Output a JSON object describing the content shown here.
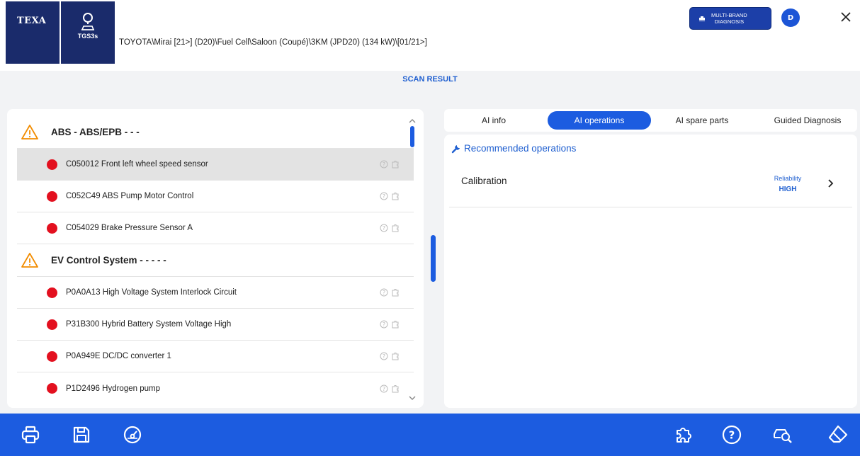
{
  "header": {
    "texa_logo": "TEXA",
    "tgs_logo": "TGS3s",
    "vehicle_path": "TOYOTA\\Mirai [21>] (D20)\\Fuel Cell\\Saloon (Coupé)\\3KM (JPD20) (134 kW)\\[01/21>]",
    "multi_brand_line1": "MULTI-BRAND",
    "multi_brand_line2": "DIAGNOSIS",
    "avatar_initial": "D"
  },
  "title": "SCAN RESULT",
  "groups": [
    {
      "label": "ABS - ABS/EPB - - -",
      "faults": [
        {
          "label": "C050012 Front left wheel speed sensor",
          "status_color": "#e3101f"
        },
        {
          "label": "C052C49 ABS Pump Motor Control",
          "status_color": "#e3101f"
        },
        {
          "label": "C054029 Brake Pressure Sensor A",
          "status_color": "#e3101f"
        }
      ]
    },
    {
      "label": "EV Control System - - - - -",
      "faults": [
        {
          "label": "P0A0A13 High Voltage System Interlock Circuit",
          "status_color": "#e3101f"
        },
        {
          "label": "P31B300 Hybrid Battery System Voltage High",
          "status_color": "#e3101f"
        },
        {
          "label": "P0A949E DC/DC converter 1",
          "status_color": "#e3101f"
        },
        {
          "label": "P1D2496 Hydrogen pump",
          "status_color": "#e3101f"
        }
      ]
    }
  ],
  "tabs": [
    {
      "label": "AI info",
      "active": false
    },
    {
      "label": "AI operations",
      "active": true
    },
    {
      "label": "AI spare parts",
      "active": false
    },
    {
      "label": "Guided Diagnosis",
      "active": false
    }
  ],
  "recommended": {
    "title": "Recommended operations",
    "operations": [
      {
        "label": "Calibration",
        "reliability_label": "Reliability",
        "reliability_value": "HIGH"
      }
    ]
  },
  "toolbar": {
    "left": [
      "print-icon",
      "save-icon",
      "speedometer-icon"
    ],
    "right": [
      "puzzle-icon",
      "help-icon",
      "car-search-icon",
      "eraser-icon"
    ]
  },
  "colors": {
    "brand_dark": "#1a2b6b",
    "accent": "#1c5ce0",
    "fault_red": "#e3101f",
    "warning_orange": "#f28c00"
  }
}
